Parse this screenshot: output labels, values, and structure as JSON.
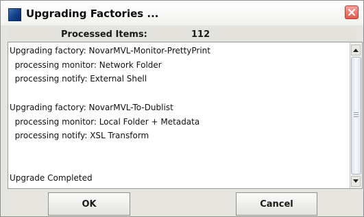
{
  "window": {
    "title": "Upgrading Factories ..."
  },
  "header": {
    "processed_label": "Processed Items:",
    "processed_count": "112"
  },
  "log": {
    "lines": [
      "Upgrading factory: NovarMVL-Monitor-PrettyPrint",
      "  processing monitor: Network Folder",
      "  processing notify: External Shell",
      "",
      "Upgrading factory: NovarMVL-To-Dublist",
      "  processing monitor: Local Folder + Metadata",
      "  processing notify: XSL Transform",
      "",
      "",
      "Upgrade Completed"
    ]
  },
  "buttons": {
    "ok_label": "OK",
    "cancel_label": "Cancel"
  },
  "icons": {
    "app": "app-icon",
    "close": "close-icon",
    "scroll_up": "arrow-up-icon",
    "scroll_down": "arrow-down-icon"
  },
  "colors": {
    "dialog_background": "#e7e5e0",
    "close_button": "#e3564e",
    "app_icon": "#0e3c86"
  }
}
